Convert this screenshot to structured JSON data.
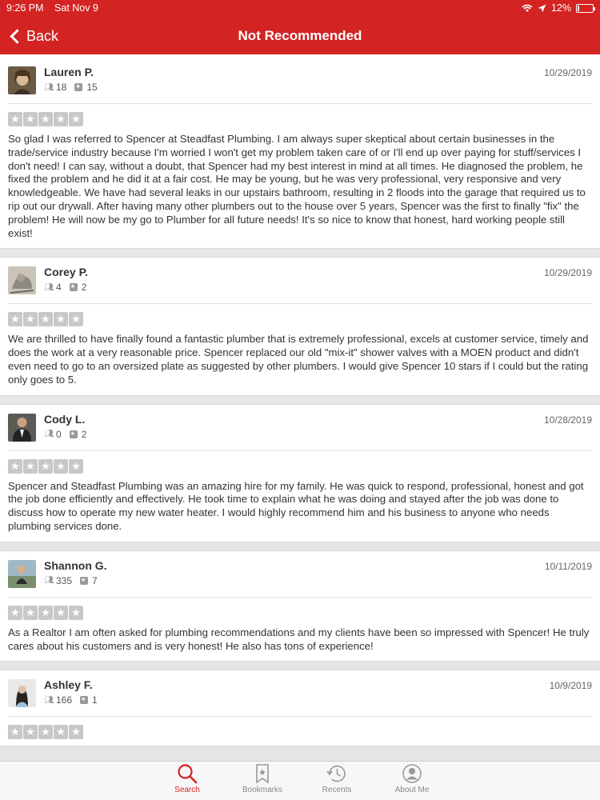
{
  "status_bar": {
    "time": "9:26 PM",
    "date": "Sat Nov 9",
    "battery": "12%",
    "battery_level": 0.12
  },
  "nav": {
    "back_label": "Back",
    "title": "Not Recommended"
  },
  "colors": {
    "brand": "#d32323",
    "star_gray": "#c8c8c8"
  },
  "reviews": [
    {
      "name": "Lauren P.",
      "friends": "18",
      "review_count": "15",
      "date": "10/29/2019",
      "stars": 5,
      "text": "So glad I was referred to Spencer at Steadfast Plumbing. I am always super skeptical about certain businesses in the trade/service industry because I'm worried I won't get my problem taken care of or I'll end up over paying for stuff/services I don't need!  I can say, without a doubt, that Spencer had my best interest in mind at all times. He diagnosed the problem, he fixed the problem and he did it at a fair cost. He may be young, but he was very professional, very responsive and very knowledgeable. We have had several leaks in our upstairs bathroom, resulting in 2 floods into the garage that required us to rip out our drywall. After having many other plumbers out to the house over 5 years, Spencer was the first to finally \"fix\" the problem!  He will now be my go to Plumber for all future needs!  It's so nice to know that honest, hard working people still exist!"
    },
    {
      "name": "Corey P.",
      "friends": "4",
      "review_count": "2",
      "date": "10/29/2019",
      "stars": 5,
      "text": "We are thrilled to have finally found a fantastic plumber that is extremely professional, excels at customer service, timely and does the work at a very reasonable price.  Spencer replaced our old \"mix-it\" shower valves with a MOEN product and didn't even need to go to an oversized plate as suggested by other plumbers.  I would give Spencer 10 stars if I could but the rating only goes to 5."
    },
    {
      "name": "Cody L.",
      "friends": "0",
      "review_count": "2",
      "date": "10/28/2019",
      "stars": 5,
      "text": "Spencer and Steadfast Plumbing was an amazing hire for my family. He was quick to respond, professional, honest and got the job done efficiently and effectively. He took time to explain what he was doing and stayed after the job was done to discuss how to operate my new water heater. I would highly recommend him and his business to anyone who needs plumbing services done."
    },
    {
      "name": "Shannon G.",
      "friends": "335",
      "review_count": "7",
      "date": "10/11/2019",
      "stars": 5,
      "text": "As a Realtor I am often asked for plumbing recommendations and my clients have been so impressed with Spencer! He truly cares about his customers and is very honest! He also has tons of experience!"
    },
    {
      "name": "Ashley F.",
      "friends": "166",
      "review_count": "1",
      "date": "10/9/2019",
      "stars": 5,
      "text": ""
    }
  ],
  "tabs": [
    {
      "label": "Search",
      "icon": "search-icon",
      "active": true
    },
    {
      "label": "Bookmarks",
      "icon": "bookmark-icon",
      "active": false
    },
    {
      "label": "Recents",
      "icon": "history-icon",
      "active": false
    },
    {
      "label": "About Me",
      "icon": "profile-icon",
      "active": false
    }
  ]
}
